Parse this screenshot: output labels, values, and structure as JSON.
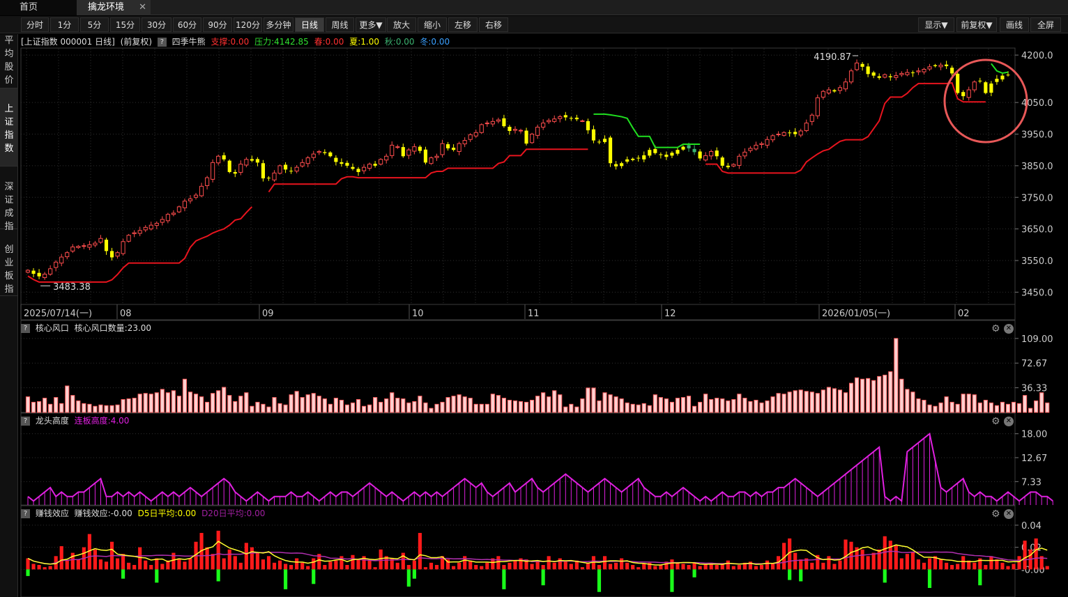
{
  "tabs": {
    "home": "首页",
    "qinlong": "擒龙环境"
  },
  "toolbar": {
    "periods": [
      "分时",
      "1分",
      "5分",
      "15分",
      "30分",
      "60分",
      "90分",
      "120分",
      "多分钟",
      "日线",
      "周线",
      "更多▼"
    ],
    "active_period": "日线",
    "zoom": [
      "放大",
      "缩小",
      "左移",
      "右移"
    ],
    "right": [
      "显示▼",
      "前复权▼",
      "画线",
      "全屏"
    ]
  },
  "sidebar": [
    "平均股价",
    "上证指数",
    "深证成指",
    "创业板指"
  ],
  "sidebar_active": "上证指数",
  "main_header": {
    "name": "[上证指数 000001 日线]",
    "adjust": "(前复权)",
    "indicator": "四季牛熊",
    "support": "支撑:0.00",
    "pressure": "压力:4142.85",
    "spring": "春:0.00",
    "summer": "夏:1.00",
    "autumn": "秋:0.00",
    "winter": "冬:0.00"
  },
  "colors": {
    "up": "#ff4d4d",
    "down_yellow": "#ffff00",
    "down_green": "#3cb371",
    "support_line": "#e8141e",
    "pressure_line": "#20e020",
    "axis_text": "#cccccc",
    "magenta": "#e020e0",
    "circle": "#e85858"
  },
  "sub1_header": {
    "name": "核心风口",
    "value": "核心风口数量:23.00"
  },
  "sub2_header": {
    "name": "龙头高度",
    "value": "连板高度:4.00"
  },
  "sub3_header": {
    "name": "赚钱效应",
    "value": "赚钱效应:-0.00",
    "d5": "D5日平均:0.00",
    "d20": "D20日平均:0.00"
  },
  "chart_data": [
    {
      "type": "candlestick",
      "title": "上证指数 000001 日线",
      "y_ticks": [
        "4200.0",
        "4050.0",
        "3950.0",
        "3850.0",
        "3750.0",
        "3650.0",
        "3550.0",
        "3450.0"
      ],
      "ylim": [
        3420,
        4220
      ],
      "x_labels": [
        "2025/07/14(一)",
        "08",
        "09",
        "10",
        "11",
        "12",
        "2026/01/05(一)",
        "02"
      ],
      "high_annotation": "4190.87",
      "low_annotation": "3483.38",
      "closes": [
        3519,
        3508,
        3500,
        3507,
        3524,
        3545,
        3561,
        3575,
        3593,
        3595,
        3597,
        3600,
        3605,
        3620,
        3580,
        3560,
        3575,
        3610,
        3630,
        3638,
        3645,
        3655,
        3662,
        3668,
        3680,
        3696,
        3700,
        3720,
        3738,
        3745,
        3757,
        3785,
        3812,
        3860,
        3880,
        3870,
        3830,
        3825,
        3855,
        3870,
        3866,
        3860,
        3810,
        3810,
        3827,
        3850,
        3838,
        3833,
        3845,
        3860,
        3875,
        3887,
        3895,
        3890,
        3880,
        3862,
        3856,
        3850,
        3840,
        3830,
        3845,
        3855,
        3850,
        3870,
        3880,
        3915,
        3910,
        3880,
        3900,
        3910,
        3897,
        3860,
        3875,
        3880,
        3920,
        3905,
        3900,
        3920,
        3930,
        3948,
        3955,
        3980,
        3985,
        3990,
        3995,
        3975,
        3960,
        3965,
        3962,
        3920,
        3950,
        3972,
        3985,
        3993,
        3998,
        4005,
        4003,
        4000,
        3997,
        3992,
        3962,
        3930,
        3925,
        3935,
        3858,
        3848,
        3858,
        3870,
        3872,
        3875,
        3883,
        3900,
        3890,
        3885,
        3878,
        3891,
        3900,
        3910,
        3905,
        3893,
        3873,
        3882,
        3895,
        3880,
        3850,
        3845,
        3854,
        3880,
        3893,
        3905,
        3915,
        3920,
        3933,
        3945,
        3950,
        3955,
        3953,
        3950,
        3960,
        3985,
        4010,
        4065,
        4085,
        4090,
        4085,
        4097,
        4115,
        4150,
        4175,
        4163,
        4140,
        4135,
        4128,
        4138,
        4130,
        4135,
        4142,
        4145,
        4143,
        4150,
        4155,
        4163,
        4165,
        4168,
        4165,
        4142,
        4080,
        4070,
        4090,
        4115,
        4117,
        4080,
        4110,
        4125,
        4135,
        4138
      ]
    },
    {
      "type": "bar",
      "title": "核心风口",
      "y_ticks": [
        "109.00",
        "72.67",
        "36.33"
      ],
      "ylim": [
        0,
        115
      ],
      "values": [
        23,
        15,
        16,
        21,
        12,
        22,
        13,
        39,
        25,
        17,
        13,
        12,
        9,
        11,
        10,
        10,
        11,
        19,
        20,
        21,
        27,
        28,
        27,
        29,
        34,
        29,
        32,
        24,
        49,
        30,
        27,
        23,
        15,
        28,
        32,
        37,
        25,
        16,
        24,
        29,
        9,
        15,
        12,
        8,
        22,
        13,
        11,
        26,
        31,
        22,
        26,
        28,
        24,
        20,
        12,
        21,
        18,
        11,
        14,
        19,
        9,
        11,
        22,
        15,
        20,
        29,
        21,
        20,
        14,
        16,
        24,
        14,
        6,
        12,
        15,
        22,
        24,
        26,
        23,
        21,
        12,
        12,
        12,
        27,
        25,
        21,
        18,
        17,
        16,
        15,
        18,
        24,
        29,
        23,
        32,
        26,
        8,
        12,
        8,
        20,
        36,
        36,
        17,
        29,
        26,
        23,
        20,
        14,
        12,
        11,
        13,
        10,
        26,
        22,
        20,
        15,
        21,
        22,
        24,
        9,
        15,
        27,
        19,
        21,
        20,
        17,
        19,
        27,
        21,
        16,
        18,
        14,
        17,
        23,
        28,
        27,
        30,
        32,
        33,
        31,
        30,
        28,
        33,
        37,
        35,
        33,
        29,
        43,
        51,
        49,
        50,
        47,
        53,
        55,
        60,
        109,
        49,
        34,
        30,
        20,
        18,
        11,
        9,
        14,
        23,
        15,
        12,
        27,
        27,
        26,
        14,
        18,
        14,
        10,
        15,
        12,
        15,
        13,
        25,
        6,
        17,
        29,
        14
      ]
    },
    {
      "type": "line",
      "title": "龙头高度",
      "y_ticks": [
        "18.00",
        "12.67",
        "7.33"
      ],
      "ylim": [
        2.1,
        19.5
      ],
      "values": [
        4,
        3,
        4,
        5,
        6,
        4,
        5,
        4,
        4,
        5,
        5,
        6,
        7,
        8,
        4,
        4,
        5,
        4,
        5,
        4,
        5,
        4,
        3,
        4,
        5,
        4,
        5,
        4,
        5,
        6,
        5,
        4,
        5,
        6,
        7,
        8,
        7,
        5,
        4,
        3,
        4,
        5,
        4,
        3,
        4,
        4,
        4,
        5,
        4,
        4,
        5,
        4,
        3,
        4,
        5,
        4,
        5,
        5,
        4,
        5,
        6,
        7,
        6,
        5,
        4,
        5,
        4,
        3,
        4,
        5,
        4,
        5,
        4,
        5,
        4,
        5,
        6,
        7,
        8,
        7,
        6,
        7,
        5,
        4,
        5,
        6,
        7,
        5,
        6,
        7,
        8,
        6,
        5,
        6,
        7,
        8,
        9,
        8,
        7,
        6,
        5,
        6,
        7,
        8,
        7,
        6,
        5,
        6,
        7,
        8,
        6,
        5,
        4,
        4,
        5,
        4,
        5,
        6,
        5,
        4,
        3,
        4,
        3,
        4,
        5,
        4,
        4,
        5,
        5,
        4,
        5,
        4,
        5,
        5,
        6,
        6,
        7,
        8,
        7,
        6,
        5,
        4,
        5,
        6,
        7,
        8,
        9,
        10,
        11,
        12,
        13,
        14,
        15,
        4,
        3,
        4,
        3,
        14,
        15,
        16,
        17,
        18,
        12,
        6,
        5,
        6,
        7,
        8,
        5,
        4,
        5,
        4,
        4,
        3,
        4,
        5,
        4,
        3,
        4,
        5,
        5,
        4,
        4,
        3
      ]
    },
    {
      "type": "bar",
      "title": "赚钱效应",
      "y_ticks": [
        "0.04",
        "0.02",
        "-0.00"
      ],
      "ylim": [
        -0.025,
        0.045
      ],
      "values": [
        0.01,
        0.005,
        0.004,
        0.002,
        0.003,
        0.012,
        0.021,
        0.008,
        0.015,
        0.009,
        0.02,
        0.032,
        0.018,
        0.009,
        0.007,
        0.025,
        0.01,
        0.014,
        0.006,
        0.004,
        0.02,
        0.008,
        0.004,
        0.01,
        0.005,
        0.008,
        0.015,
        0.01,
        0.007,
        0.01,
        0.025,
        0.033,
        0.02,
        0.014,
        0.035,
        0.01,
        0.018,
        0.012,
        0.006,
        0.024,
        0.02,
        0.015,
        0.009,
        0.012,
        0.006,
        0.008,
        0.005,
        0.004,
        0.01,
        0.006,
        0.003,
        0.01,
        0.014,
        0.004,
        0.007,
        0.008,
        0.012,
        0.004,
        0.013,
        0.009,
        0.012,
        0.008,
        0.002,
        0.018,
        0.012,
        0.01,
        0.006,
        0.015,
        0.004,
        0.008,
        0.033,
        0.002,
        0.006,
        0.004,
        0.012,
        0.009,
        0.003,
        0.006,
        0.012,
        0.008,
        0.004,
        0.003,
        0.006,
        0.01,
        0.012,
        0.004,
        0.006,
        0.008,
        0.01,
        0.009,
        0.005,
        0.008,
        0.004,
        0.012,
        0.006,
        0.01,
        0.007,
        0.005,
        0.008,
        0.002,
        0.006,
        0.012,
        0.004,
        0.012,
        0.005,
        0.006,
        0.01,
        0.006,
        0.004,
        0.002,
        0.005,
        0.006,
        0.003,
        0.004,
        0.007,
        0.009,
        0.006,
        0.005,
        0.004,
        0.006,
        0.003,
        0.005,
        0.006,
        0.004,
        0.005,
        0.008,
        0.003,
        0.004,
        0.006,
        0.007,
        0.003,
        0.004,
        0.008,
        0.005,
        0.012,
        0.024,
        0.028,
        0.015,
        0.009,
        0.01,
        0.006,
        0.013,
        0.006,
        0.012,
        0.005,
        0.008,
        0.027,
        0.025,
        0.02,
        0.018,
        0.012,
        0.015,
        0.018,
        0.03,
        0.026,
        0.022,
        0.01,
        0.014,
        0.016,
        0.009,
        0.006,
        0.01,
        0.012,
        0.009,
        0.006,
        0.004,
        0.005,
        0.012,
        0.008,
        0.006,
        0.01,
        0.004,
        0.012,
        0.009,
        0.006,
        0.003,
        0.005,
        0.012,
        0.026,
        0.018,
        0.028,
        0.012,
        0.003
      ]
    }
  ]
}
